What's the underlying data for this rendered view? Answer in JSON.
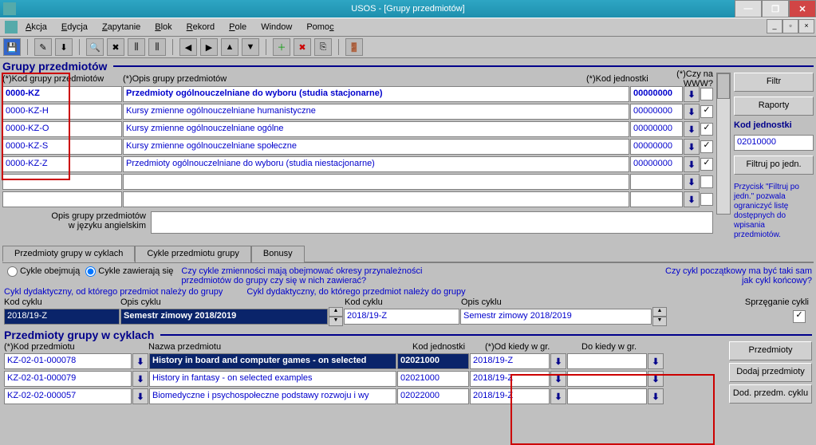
{
  "window": {
    "title": "USOS - [Grupy przedmiotów]"
  },
  "menu": {
    "akcja": "Akcja",
    "edycja": "Edycja",
    "zapytanie": "Zapytanie",
    "blok": "Blok",
    "rekord": "Rekord",
    "pole": "Pole",
    "window": "Window",
    "pomoc": "Pomoc"
  },
  "headers1": {
    "kod": "(*)Kod grupy przedmiotów",
    "opis": "(*)Opis grupy przedmiotów",
    "jedn": "(*)Kod jednostki",
    "www": "(*)Czy na WWW?"
  },
  "section1_title": "Grupy przedmiotów",
  "rows1": [
    {
      "kod": "0000-KZ",
      "opis": "Przedmioty ogólnouczelniane do wyboru (studia stacjonarne)",
      "jedn": "00000000",
      "www": false
    },
    {
      "kod": "0000-KZ-H",
      "opis": "Kursy zmienne ogólnouczelniane humanistyczne",
      "jedn": "00000000",
      "www": true
    },
    {
      "kod": "0000-KZ-O",
      "opis": "Kursy zmienne ogólnouczelniane ogólne",
      "jedn": "00000000",
      "www": true
    },
    {
      "kod": "0000-KZ-S",
      "opis": "Kursy zmienne ogólnouczelniane społeczne",
      "jedn": "00000000",
      "www": true
    },
    {
      "kod": "0000-KZ-Z",
      "opis": "Przedmioty ogólnouczelniane do wyboru (studia niestacjonarne)",
      "jedn": "00000000",
      "www": true
    },
    {
      "kod": "",
      "opis": "",
      "jedn": "",
      "www": false
    },
    {
      "kod": "",
      "opis": "",
      "jedn": "",
      "www": false
    }
  ],
  "english_label": "Opis grupy przedmiotów\nw języku angielskim",
  "right": {
    "filtr": "Filtr",
    "raporty": "Raporty",
    "kodj_label": "Kod jednostki",
    "kodj_value": "02010000",
    "filtruj": "Filtruj po jedn.",
    "hint": "Przycisk \"Filtruj po jedn.\" pozwala ograniczyć listę dostępnych do wpisania przedmiotów."
  },
  "tabs": {
    "t1": "Przedmioty grupy w cyklach",
    "t2": "Cykle przedmiotu grupy",
    "t3": "Bonusy"
  },
  "cycle_opts": {
    "obejmuja": "Cykle obejmują",
    "zawieraja": "Cykle zawierają się"
  },
  "cycle_q": "Czy cykle zmienności mają obejmować okresy przynależności przedmiotów do grupy czy się w nich zawierać?",
  "cycle_note": "Czy cykl początkowy ma być taki sam jak cykl końcowy?",
  "link1": "Cykl dydaktyczny, od którego przedmiot należy do grupy",
  "link2": "Cykl dydaktyczny, do którego przedmiot należy do grupy",
  "cycle_cols": {
    "kod": "Kod cyklu",
    "opis": "Opis cyklu",
    "sprz": "Sprzęganie cykli"
  },
  "cycle_row": {
    "kod1": "2018/19-Z",
    "opis1": "Semestr zimowy 2018/2019",
    "kod2": "2018/19-Z",
    "opis2": "Semestr zimowy 2018/2019"
  },
  "section2_title": "Przedmioty grupy w cyklach",
  "headers2": {
    "kod": "(*)Kod przedmiotu",
    "nazwa": "Nazwa przedmiotu",
    "jedn": "Kod jednostki",
    "od": "(*)Od kiedy w gr.",
    "do": "Do kiedy w gr."
  },
  "rows2": [
    {
      "kod": "KZ-02-01-000078",
      "nazwa": "History in board and computer games - on selected",
      "jedn": "02021000",
      "od": "2018/19-Z",
      "do": "",
      "sel": true
    },
    {
      "kod": "KZ-02-01-000079",
      "nazwa": "History in  fantasy - on selected examples",
      "jedn": "02021000",
      "od": "2018/19-Z",
      "do": "",
      "sel": false
    },
    {
      "kod": "KZ-02-02-000057",
      "nazwa": "Biomedyczne i psychospołeczne podstawy rozwoju i wy",
      "jedn": "02022000",
      "od": "2018/19-Z",
      "do": "",
      "sel": false
    }
  ],
  "right2": {
    "przedmioty": "Przedmioty",
    "dodaj": "Dodaj przedmioty",
    "dodcykl": "Dod. przedm. cyklu"
  }
}
